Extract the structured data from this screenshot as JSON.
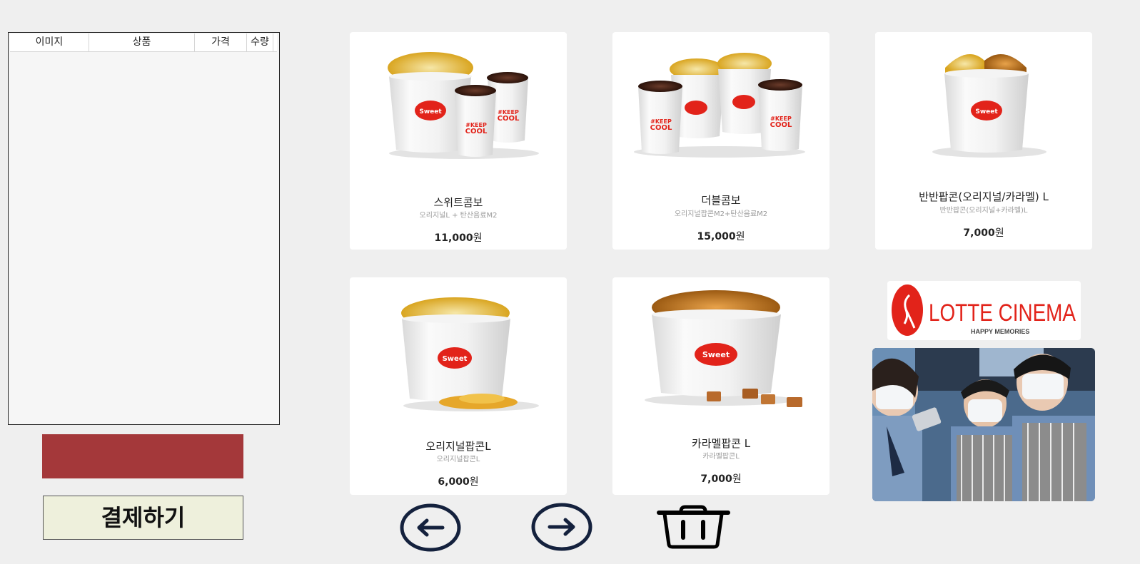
{
  "cart": {
    "columns": {
      "image": "이미지",
      "product": "상품",
      "price": "가격",
      "qty": "수량"
    }
  },
  "actions": {
    "pay_label": "결제하기"
  },
  "colors": {
    "total_bar": "#a4383a",
    "pay_button": "#eef0dc",
    "brand_red": "#e2231a",
    "nav_icon": "#14213d"
  },
  "products": [
    {
      "name": "스위트콤보",
      "desc": "오리지널L + 탄산음료M2",
      "price": "11,000",
      "currency": "원"
    },
    {
      "name": "더블콤보",
      "desc": "오리지널팝콘M2+탄산음료M2",
      "price": "15,000",
      "currency": "원"
    },
    {
      "name": "반반팝콘(오리지널/카라멜) L",
      "desc": "반반팝콘(오리지널+카라멜)L",
      "price": "7,000",
      "currency": "원"
    },
    {
      "name": "오리지널팝콘L",
      "desc": "오리지널팝콘L",
      "price": "6,000",
      "currency": "원"
    },
    {
      "name": "카라멜팝콘 L",
      "desc": "카라멜팝콘L",
      "price": "7,000",
      "currency": "원"
    }
  ],
  "cup_labels": {
    "brand": "Sweet",
    "slogan_top": "#KEEP",
    "slogan_bottom": "COOL"
  },
  "brand": {
    "logo_text": "LOTTE CINEMA",
    "tagline": "HAPPY MEMORIES"
  },
  "icons": {
    "prev": "arrow-left-icon",
    "next": "arrow-right-icon",
    "trash": "trash-icon"
  }
}
